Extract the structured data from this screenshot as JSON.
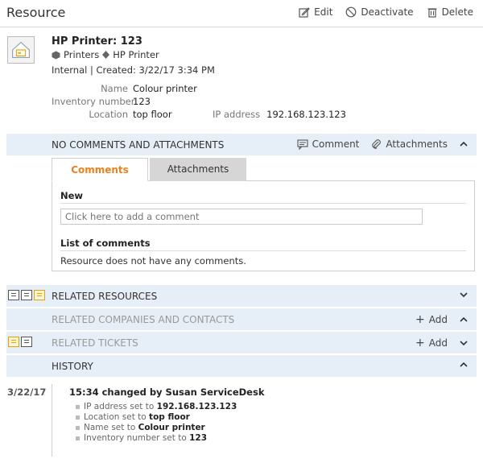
{
  "header": {
    "title": "Resource",
    "edit_label": "Edit",
    "deactivate_label": "Deactivate",
    "delete_label": "Delete"
  },
  "resource": {
    "name": "HP Printer: 123",
    "crumb_1": "Printers",
    "crumb_2": "HP Printer",
    "meta": "Internal | Created: 3/22/17 3:34 PM",
    "properties": [
      {
        "label": "Name",
        "value": "Colour printer"
      },
      {
        "label": "Inventory number",
        "value": "123"
      },
      {
        "label": "Location",
        "value": "top floor"
      },
      {
        "label": "IP address",
        "value": "192.168.123.123"
      }
    ]
  },
  "comments_section": {
    "title": "NO COMMENTS AND ATTACHMENTS",
    "comment_action": "Comment",
    "attachments_action": "Attachments",
    "tabs": [
      "Comments",
      "Attachments"
    ],
    "new_heading": "New",
    "input_placeholder": "Click here to add a comment",
    "list_heading": "List of comments",
    "empty_text": "Resource does not have any comments."
  },
  "sections": {
    "related_resources": "RELATED RESOURCES",
    "related_companies": "RELATED COMPANIES AND CONTACTS",
    "related_tickets": "RELATED TICKETS",
    "add_label": "Add",
    "history": "HISTORY"
  },
  "history": {
    "date": "3/22/17",
    "entry_title": "15:34 changed by Susan ServiceDesk",
    "set_word": "set to",
    "changes": [
      {
        "field": "IP address",
        "value": "192.168.123.123"
      },
      {
        "field": "Location",
        "value": "top floor"
      },
      {
        "field": "Name",
        "value": "Colour printer"
      },
      {
        "field": "Inventory number",
        "value": "123"
      }
    ]
  },
  "colors": {
    "section_bg": "#e6eef7",
    "active_tab": "#e8821e",
    "accent_orange": "#e8a200"
  }
}
